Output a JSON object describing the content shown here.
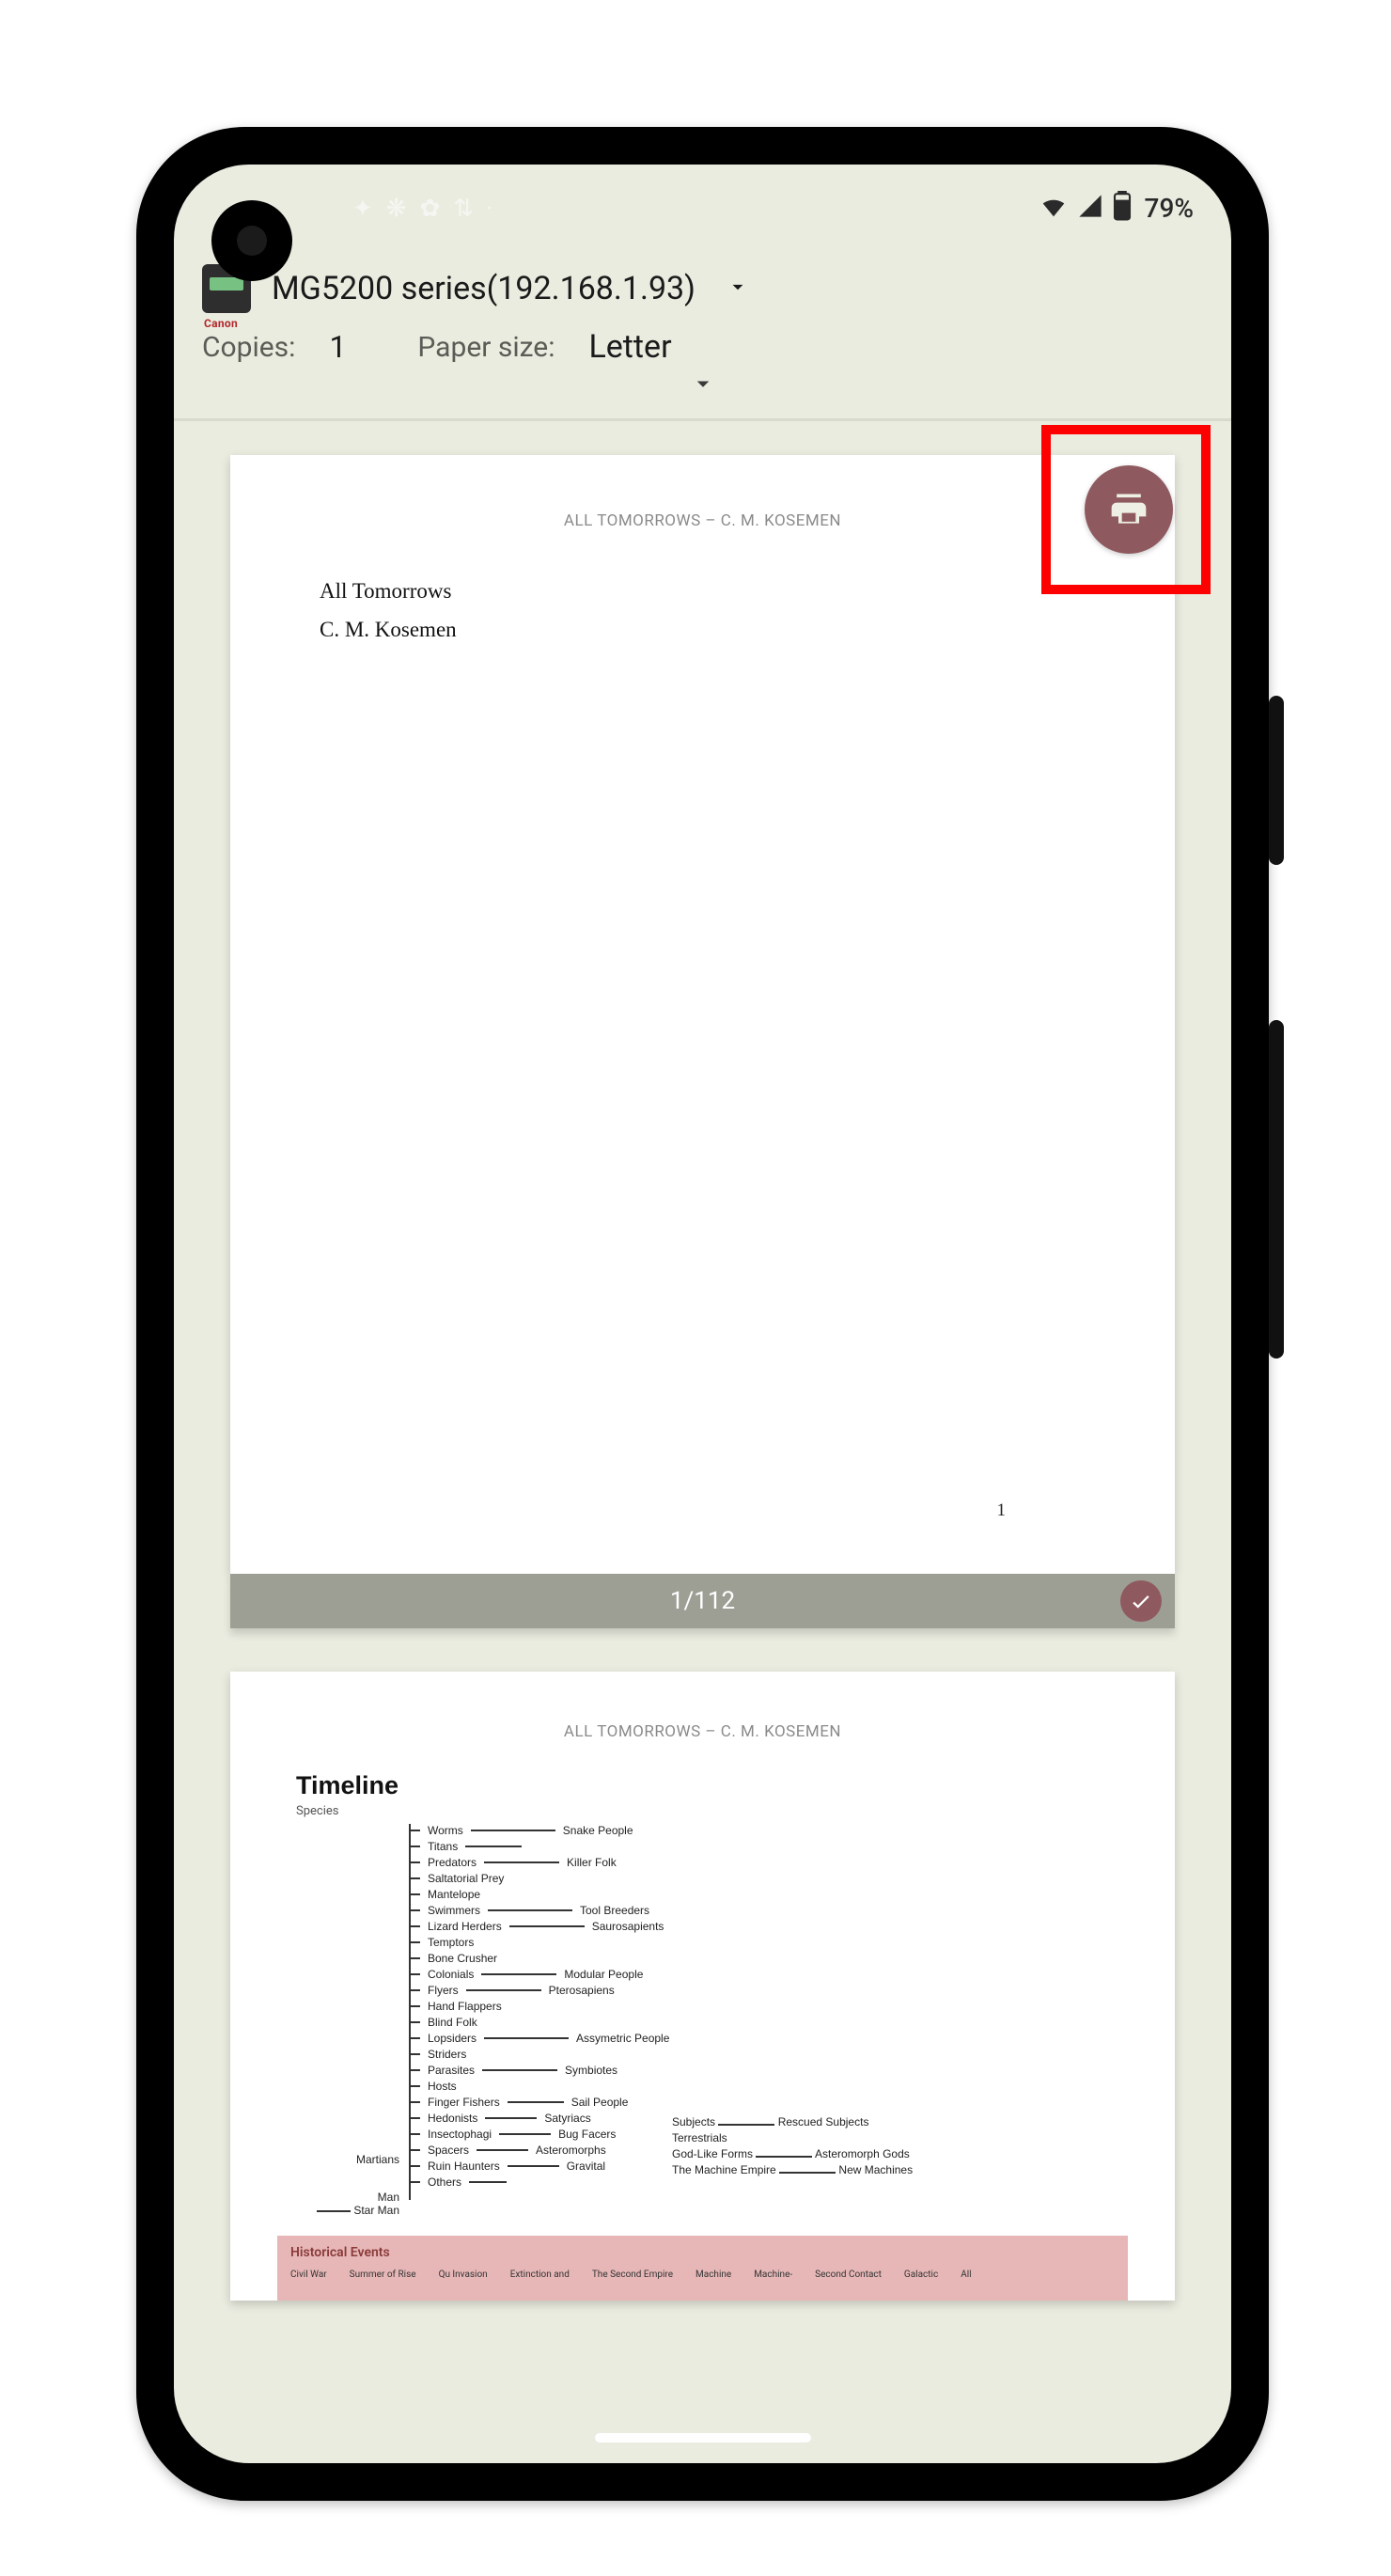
{
  "status": {
    "battery_pct": "79%"
  },
  "header": {
    "printer_name": "MG5200 series(192.168.1.93)",
    "printer_brand": "Canon",
    "copies_label": "Copies:",
    "copies_value": "1",
    "paper_label": "Paper size:",
    "paper_value": "Letter"
  },
  "preview": {
    "doc_header": "ALL TOMORROWS – C. M. KOSEMEN",
    "title": "All Tomorrows",
    "author": "C. M. Kosemen",
    "page_number": "1",
    "page_counter": "1/112"
  },
  "page2": {
    "doc_header": "ALL TOMORROWS – C. M. KOSEMEN",
    "timeline_heading": "Timeline",
    "species_label": "Species",
    "left_labels": {
      "martians": "Martians",
      "man": "Man",
      "star_man": "Star Man"
    },
    "rows": [
      {
        "name": "Worms",
        "dest": "Snake People",
        "len": 90
      },
      {
        "name": "Titans",
        "dest": "",
        "len": 60
      },
      {
        "name": "Predators",
        "dest": "Killer Folk",
        "len": 80
      },
      {
        "name": "Saltatorial Prey",
        "dest": "",
        "len": 0
      },
      {
        "name": "Mantelope",
        "dest": "",
        "len": 0
      },
      {
        "name": "Swimmers",
        "dest": "Tool Breeders",
        "len": 90
      },
      {
        "name": "Lizard Herders",
        "dest": "Saurosapients",
        "len": 80
      },
      {
        "name": "Temptors",
        "dest": "",
        "len": 0
      },
      {
        "name": "Bone Crusher",
        "dest": "",
        "len": 0
      },
      {
        "name": "Colonials",
        "dest": "Modular People",
        "len": 80
      },
      {
        "name": "Flyers",
        "dest": "Pterosapiens",
        "len": 80
      },
      {
        "name": "Hand Flappers",
        "dest": "",
        "len": 0
      },
      {
        "name": "Blind Folk",
        "dest": "",
        "len": 0
      },
      {
        "name": "Lopsiders",
        "dest": "Assymetric People",
        "len": 90
      },
      {
        "name": "Striders",
        "dest": "",
        "len": 0
      },
      {
        "name": "Parasites",
        "dest": "Symbiotes",
        "len": 80
      },
      {
        "name": "Hosts",
        "dest": "",
        "len": 0
      },
      {
        "name": "Finger Fishers",
        "dest": "Sail People",
        "len": 60
      },
      {
        "name": "Hedonists",
        "dest": "Satyriacs",
        "len": 55
      },
      {
        "name": "Insectophagi",
        "dest": "Bug Facers",
        "len": 55
      },
      {
        "name": "Spacers",
        "dest": "Asteromorphs",
        "len": 55
      },
      {
        "name": "Ruin Haunters",
        "dest": "Gravital",
        "len": 55
      },
      {
        "name": "Others",
        "dest": "",
        "len": 40
      }
    ],
    "col3": [
      {
        "left": "Subjects",
        "right": "Rescued Subjects"
      },
      {
        "left": "",
        "right": "Terrestrials"
      },
      {
        "left": "God-Like Forms",
        "right": "Asteromorph Gods"
      },
      {
        "left": "The Machine Empire",
        "right": "New Machines"
      }
    ],
    "historical": {
      "title": "Historical Events",
      "items": [
        "Civil War",
        "Summer of Rise",
        "Qu Invasion",
        "Extinction and",
        "The Second Empire",
        "Machine",
        "Machine-",
        "Second Contact",
        "Galactic",
        "All"
      ]
    }
  }
}
